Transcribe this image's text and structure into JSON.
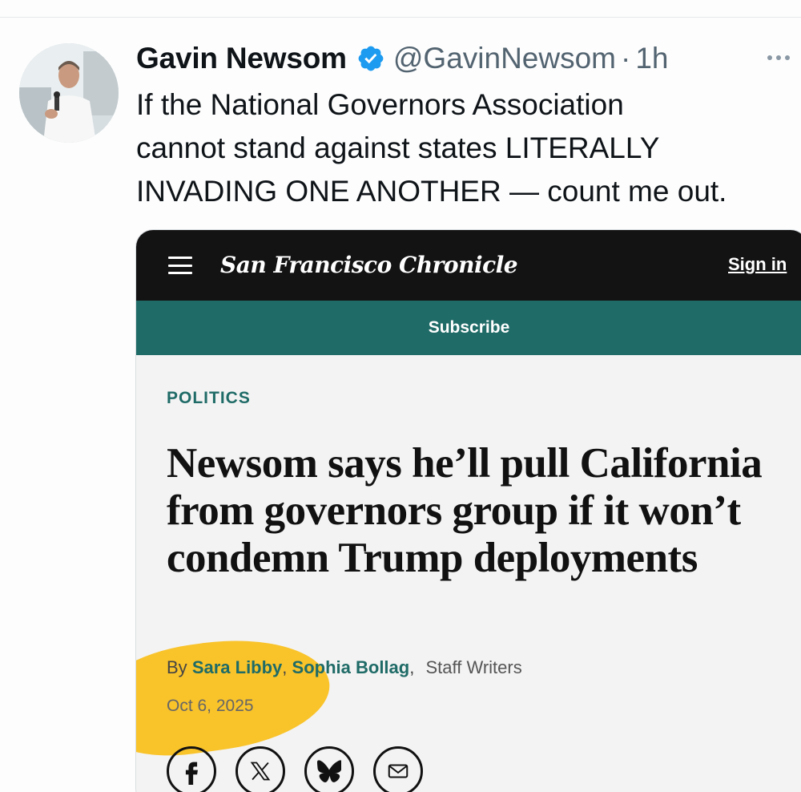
{
  "tweet": {
    "author": {
      "display_name": "Gavin Newsom",
      "handle": "@GavinNewsom",
      "verified": true,
      "avatar": "profile-photo"
    },
    "time_separator": "·",
    "time": "1h",
    "text": "If the National Governors Association\ncannot stand against states LITERALLY\nINVADING ONE ANOTHER — count me out.",
    "more_icon": "more-horizontal-icon"
  },
  "article_card": {
    "masthead": "San Francisco Chronicle",
    "menu_icon": "hamburger-menu-icon",
    "sign_in_label": "Sign in",
    "subscribe_label": "Subscribe",
    "section": "POLITICS",
    "headline": "Newsom says he’ll pull California from governors group if it won’t condemn Trump deployments",
    "byline": {
      "prefix": "By",
      "authors": [
        "Sara Libby",
        "Sophia Bollag"
      ],
      "separator": ",",
      "role": "Staff Writers"
    },
    "date": "Oct 6, 2025",
    "share_icons": [
      "facebook-icon",
      "x-icon",
      "bluesky-icon",
      "email-icon"
    ]
  },
  "colors": {
    "verified_blue": "#1d9bf0",
    "secondary_text": "#536471",
    "chronicle_bar": "#131313",
    "subscribe_teal": "#1f6b67",
    "highlight_yellow": "#f9be14"
  }
}
